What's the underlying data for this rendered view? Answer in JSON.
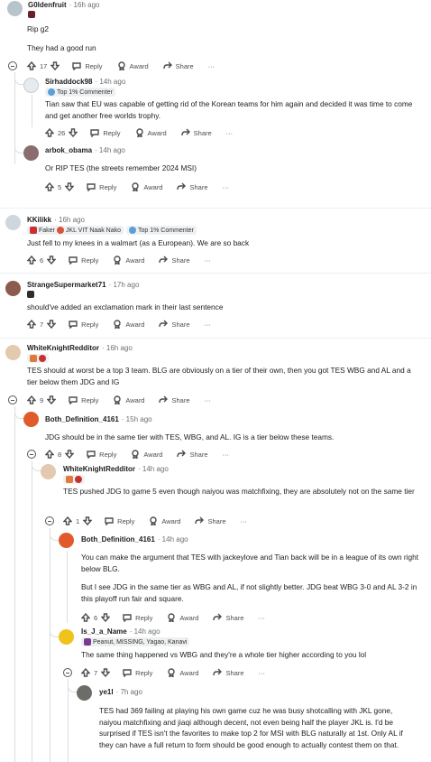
{
  "actions": {
    "reply": "Reply",
    "award": "Award",
    "share": "Share",
    "more": "···"
  },
  "colors": {
    "thread_line": "#dadde0",
    "meta_text": "#6b6f73",
    "action_text": "#4a4e52"
  },
  "comments": {
    "c1": {
      "author": "G0ldenfruit",
      "time": "· 16h ago",
      "body": [
        "Rip g2",
        "They had a good run"
      ],
      "votes": "17"
    },
    "c2": {
      "author": "Sirhaddock98",
      "time": "· 14h ago",
      "badge": "Top 1% Commenter",
      "body": [
        "Tian saw that EU was capable of getting rid of the Korean teams for him again and decided it was time to come and get another free worlds trophy."
      ],
      "votes": "26"
    },
    "c3": {
      "author": "arbok_obama",
      "time": "· 14h ago",
      "body": [
        "Or RIP TES (the streets remember 2024 MSI)"
      ],
      "votes": "5"
    },
    "c4": {
      "author": "KKilikk",
      "time": "· 16h ago",
      "flair": "Faker",
      "flair2": "JKL VIT Naak Nako",
      "badge": "Top 1% Commenter",
      "body": [
        "Just fell to my knees in a walmart (as a European). We are so back"
      ],
      "votes": "6"
    },
    "c5": {
      "author": "StrangeSupermarket71",
      "time": "· 17h ago",
      "body": [
        "should've added an exclamation mark in their last sentence"
      ],
      "votes": "7"
    },
    "c6": {
      "author": "WhiteKnightRedditor",
      "time": "· 16h ago",
      "body": [
        "TES should at worst be a top 3 team. BLG are obviously on a tier of their own, then you got TES WBG and AL and a tier below them JDG and IG"
      ],
      "votes": "9"
    },
    "c7": {
      "author": "Both_Definition_4161",
      "time": "· 15h ago",
      "body": [
        "JDG should be in the same tier with TES, WBG, and AL. IG is a tier below these teams."
      ],
      "votes": "8"
    },
    "c8": {
      "author": "WhiteKnightRedditor",
      "time": "· 14h ago",
      "body": [
        "TES pushed JDG to game 5 even though naiyou was matchfixing, they are absolutely not on the same tier"
      ],
      "votes": "1"
    },
    "c9": {
      "author": "Both_Definition_4161",
      "time": "· 14h ago",
      "body": [
        "You can make the argument that TES with jackeylove and Tian back will be in a league of its own right below BLG.",
        "But I see JDG in the same tier as WBG and AL, if not slightly better. JDG beat WBG 3-0 and AL 3-2 in this playoff run fair and square."
      ],
      "votes": "6"
    },
    "c10": {
      "author": "Is_J_a_Name",
      "time": "· 14h ago",
      "flair": "Peanut, MISSING, Yagao, Kanavi",
      "body": [
        "The same thing happened vs WBG and they're a whole tier higher according to you lol"
      ],
      "votes": "7"
    },
    "c11": {
      "author": "ye1l",
      "time": "· 7h ago",
      "body": [
        "TES had 369 failing at playing his own game cuz he was busy shotcalling with JKL gone, naiyou matchfixing and jiaqi although decent, not even being half the player JKL is. I'd be surprised if TES isn't the favorites to make top 2 for MSI with BLG naturally at 1st. Only AL if they can have a full return to form should be good enough to actually contest them on that."
      ]
    }
  }
}
